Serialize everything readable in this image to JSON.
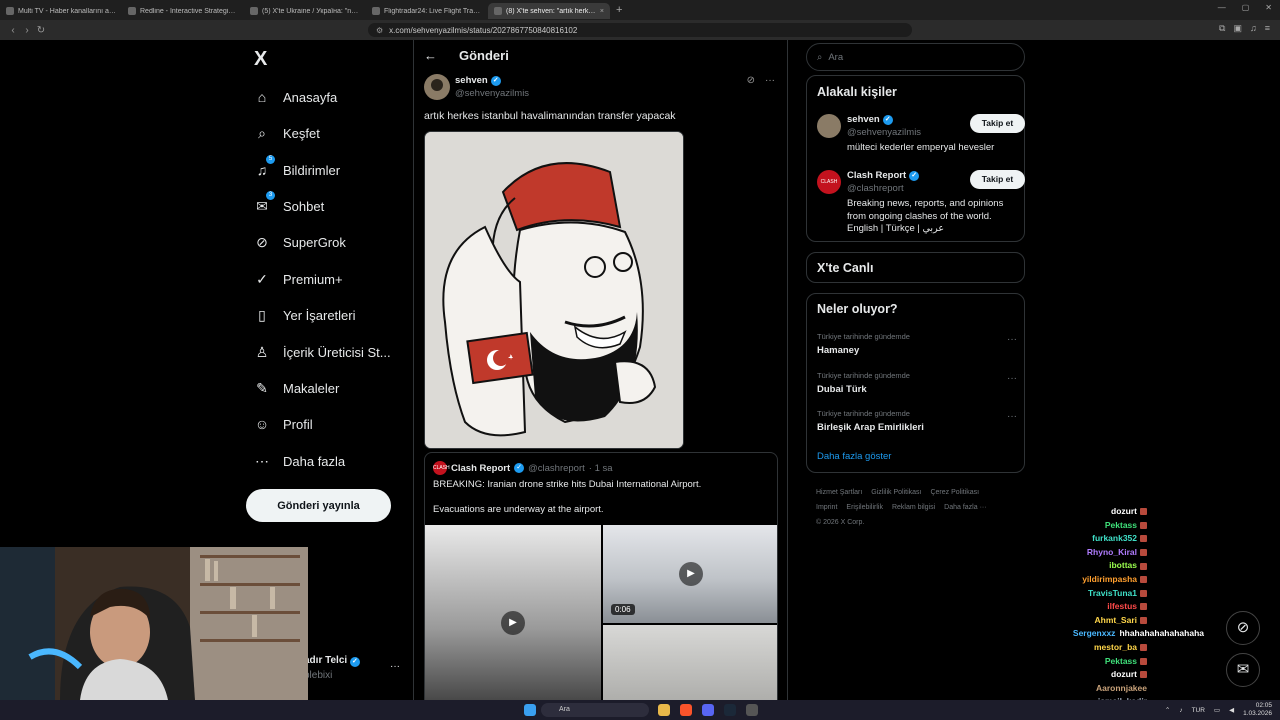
{
  "browser": {
    "tabs": [
      {
        "title": "Multi TV - Haber kanallarını aynı anda",
        "active": false
      },
      {
        "title": "Redline - Interactive Strategic Map",
        "active": false
      },
      {
        "title": "(5) X'te Ukraine / Україна: \"nothing",
        "active": false
      },
      {
        "title": "Flightradar24: Live Flight Tracker - R",
        "active": false
      },
      {
        "title": "(8) X'te sehven: \"artık herkes i",
        "active": true
      }
    ],
    "new_tab": "+",
    "url": "x.com/sehvenyazilmis/status/2027867750840816102"
  },
  "nav": {
    "logo": "X",
    "items": [
      {
        "label": "Anasayfa",
        "icon": "home-icon",
        "glyph": "⌂",
        "badge": ""
      },
      {
        "label": "Keşfet",
        "icon": "search-icon",
        "glyph": "⌕",
        "badge": ""
      },
      {
        "label": "Bildirimler",
        "icon": "bell-icon",
        "glyph": "♫",
        "badge": "5"
      },
      {
        "label": "Sohbet",
        "icon": "mail-icon",
        "glyph": "✉",
        "badge": "3"
      },
      {
        "label": "SuperGrok",
        "icon": "grok-icon",
        "glyph": "⊘",
        "badge": ""
      },
      {
        "label": "Premium+",
        "icon": "premium-icon",
        "glyph": "✓",
        "badge": ""
      },
      {
        "label": "Yer İşaretleri",
        "icon": "bookmark-icon",
        "glyph": "▯",
        "badge": ""
      },
      {
        "label": "İçerik Üreticisi St...",
        "icon": "creator-icon",
        "glyph": "♙",
        "badge": ""
      },
      {
        "label": "Makaleler",
        "icon": "articles-icon",
        "glyph": "✎",
        "badge": ""
      },
      {
        "label": "Profil",
        "icon": "profile-icon",
        "glyph": "☺",
        "badge": ""
      },
      {
        "label": "Daha fazla",
        "icon": "more-circle-icon",
        "glyph": "⋯",
        "badge": ""
      }
    ],
    "post_button": "Gönderi yayınla",
    "account": {
      "name": "adır Telci",
      "handle": "plebixi",
      "more": "···"
    }
  },
  "main": {
    "title": "Gönderi",
    "tweet": {
      "author": "sehven",
      "handle": "@sehvenyazilmis",
      "text": "artık herkes istanbul havalimanından transfer yapacak"
    },
    "quote": {
      "author": "Clash Report",
      "handle": "@clashreport",
      "time": "· 1 sa",
      "text1": "BREAKING: Iranian drone strike hits Dubai International Airport.",
      "text2": "Evacuations are underway at the airport.",
      "video_duration": "0:06"
    }
  },
  "sidebar": {
    "search_placeholder": "Ara",
    "related_title": "Alakalı kişiler",
    "people": [
      {
        "name": "sehven",
        "handle": "@sehvenyazilmis",
        "bio": "mülteci kederler emperyal hevesler",
        "follow": "Takip et"
      },
      {
        "name": "Clash Report",
        "handle": "@clashreport",
        "bio": "Breaking news, reports, and opinions from ongoing clashes of the world. English | Türkçe | عربي",
        "follow": "Takip et"
      }
    ],
    "live_title": "X'te Canlı",
    "trends_title": "Neler oluyor?",
    "trends": [
      {
        "meta": "Türkiye tarihinde gündemde",
        "name": "Hamaney"
      },
      {
        "meta": "Türkiye tarihinde gündemde",
        "name": "Dubai Türk"
      },
      {
        "meta": "Türkiye tarihinde gündemde",
        "name": "Birleşik Arap Emirlikleri"
      }
    ],
    "show_more": "Daha fazla göster",
    "footer": [
      "Hizmet Şartları",
      "Gizlilik Politikası",
      "Çerez Politikası",
      "Imprint",
      "Erişilebilirlik",
      "Reklam bilgisi",
      "Daha fazla ···",
      "© 2026 X Corp."
    ]
  },
  "chat": [
    {
      "user": "dozurt",
      "msg": "",
      "color": "#ffffff"
    },
    {
      "user": "Pektass",
      "msg": "",
      "color": "#3fe07a"
    },
    {
      "user": "furkank352",
      "msg": "",
      "color": "#3fe0c8"
    },
    {
      "user": "Rhyno_Kiral",
      "msg": "",
      "color": "#b07cff"
    },
    {
      "user": "ibottas",
      "msg": "",
      "color": "#9bff4f"
    },
    {
      "user": "yildirimpasha",
      "msg": "",
      "color": "#ff9f2e"
    },
    {
      "user": "TravisTuna1",
      "msg": "",
      "color": "#3fe0c8"
    },
    {
      "user": "ilfestus",
      "msg": "",
      "color": "#ff4a4a"
    },
    {
      "user": "Ahmt_Sari",
      "msg": "",
      "color": "#ffd64a"
    },
    {
      "user": "Sergenxxz",
      "msg": "hhahahahahahahaha",
      "color": "#4ab8ff"
    },
    {
      "user": "mestor_ba",
      "msg": "",
      "color": "#ffd64a"
    },
    {
      "user": "Pektass",
      "msg": "",
      "color": "#3fe07a"
    },
    {
      "user": "dozurt",
      "msg": "",
      "color": "#ffffff"
    },
    {
      "user": "Aaronnjakee",
      "msg": "",
      "color": "#c8a27a"
    },
    {
      "user": "ismail_kadir",
      "msg": "",
      "color": "#9aa3b5"
    }
  ],
  "taskbar": {
    "search": "Ara",
    "lang": "TUR",
    "time": "02:05",
    "date": "1.03.2026"
  }
}
